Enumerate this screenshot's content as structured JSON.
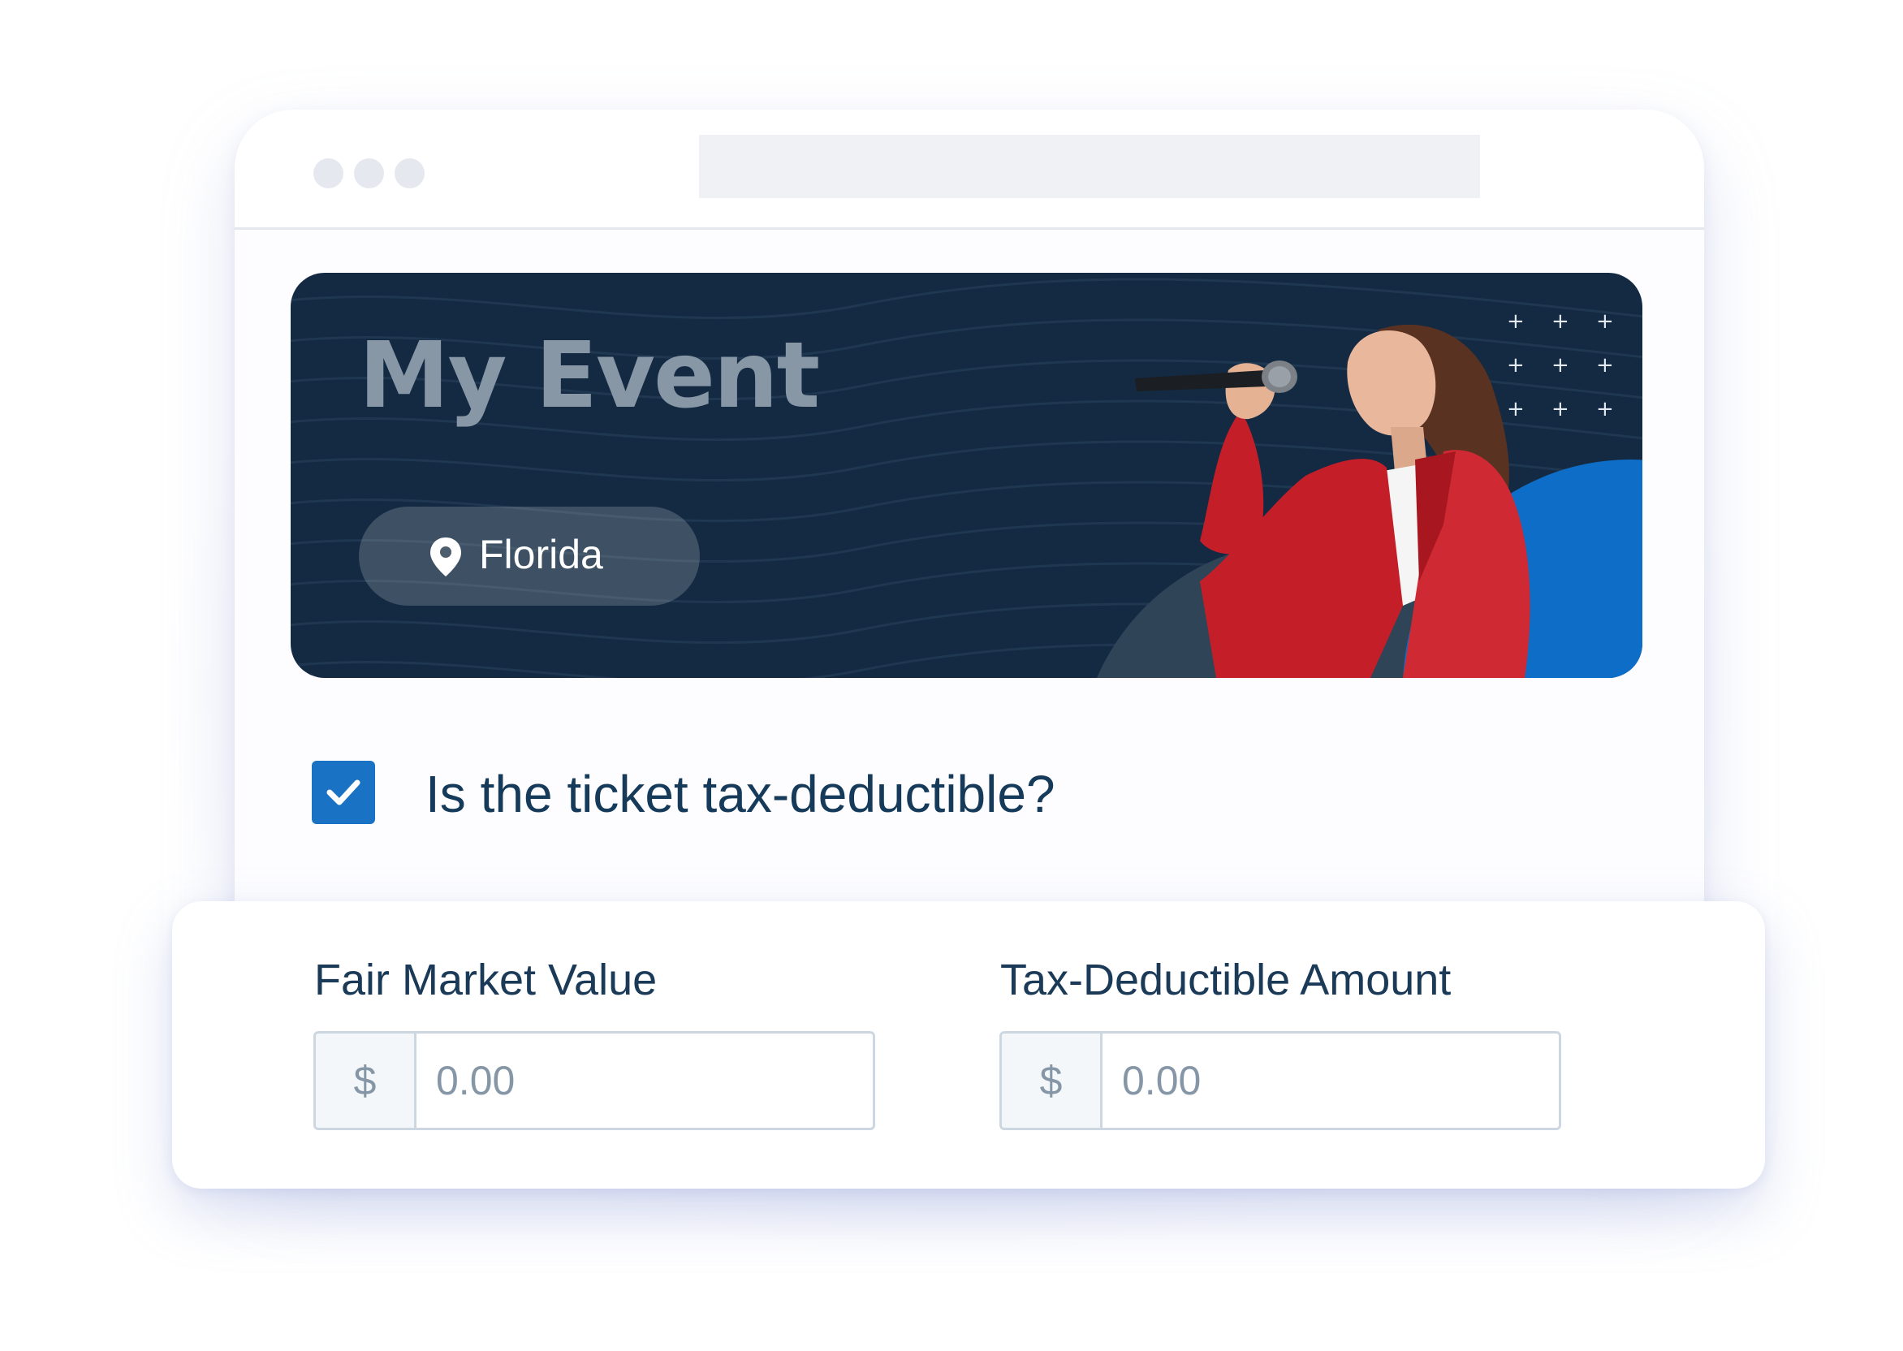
{
  "browser": {
    "window_controls": [
      "dot",
      "dot",
      "dot"
    ],
    "address_bar": ""
  },
  "event": {
    "title": "My Event",
    "location": "Florida",
    "location_icon": "map-pin-icon",
    "banner_decoration": "plus-grid"
  },
  "tax_deductible": {
    "question": "Is the ticket tax-deductible?",
    "checked": true
  },
  "amounts": {
    "fair_market_value": {
      "label": "Fair Market Value",
      "currency_symbol": "$",
      "placeholder": "0.00"
    },
    "tax_deductible_amount": {
      "label": "Tax-Deductible Amount",
      "currency_symbol": "$",
      "placeholder": "0.00"
    }
  },
  "colors": {
    "banner_background": "#142a42",
    "accent_blue": "#1a72c4",
    "title_gray": "#8797a6",
    "text_navy": "#163a5a"
  }
}
